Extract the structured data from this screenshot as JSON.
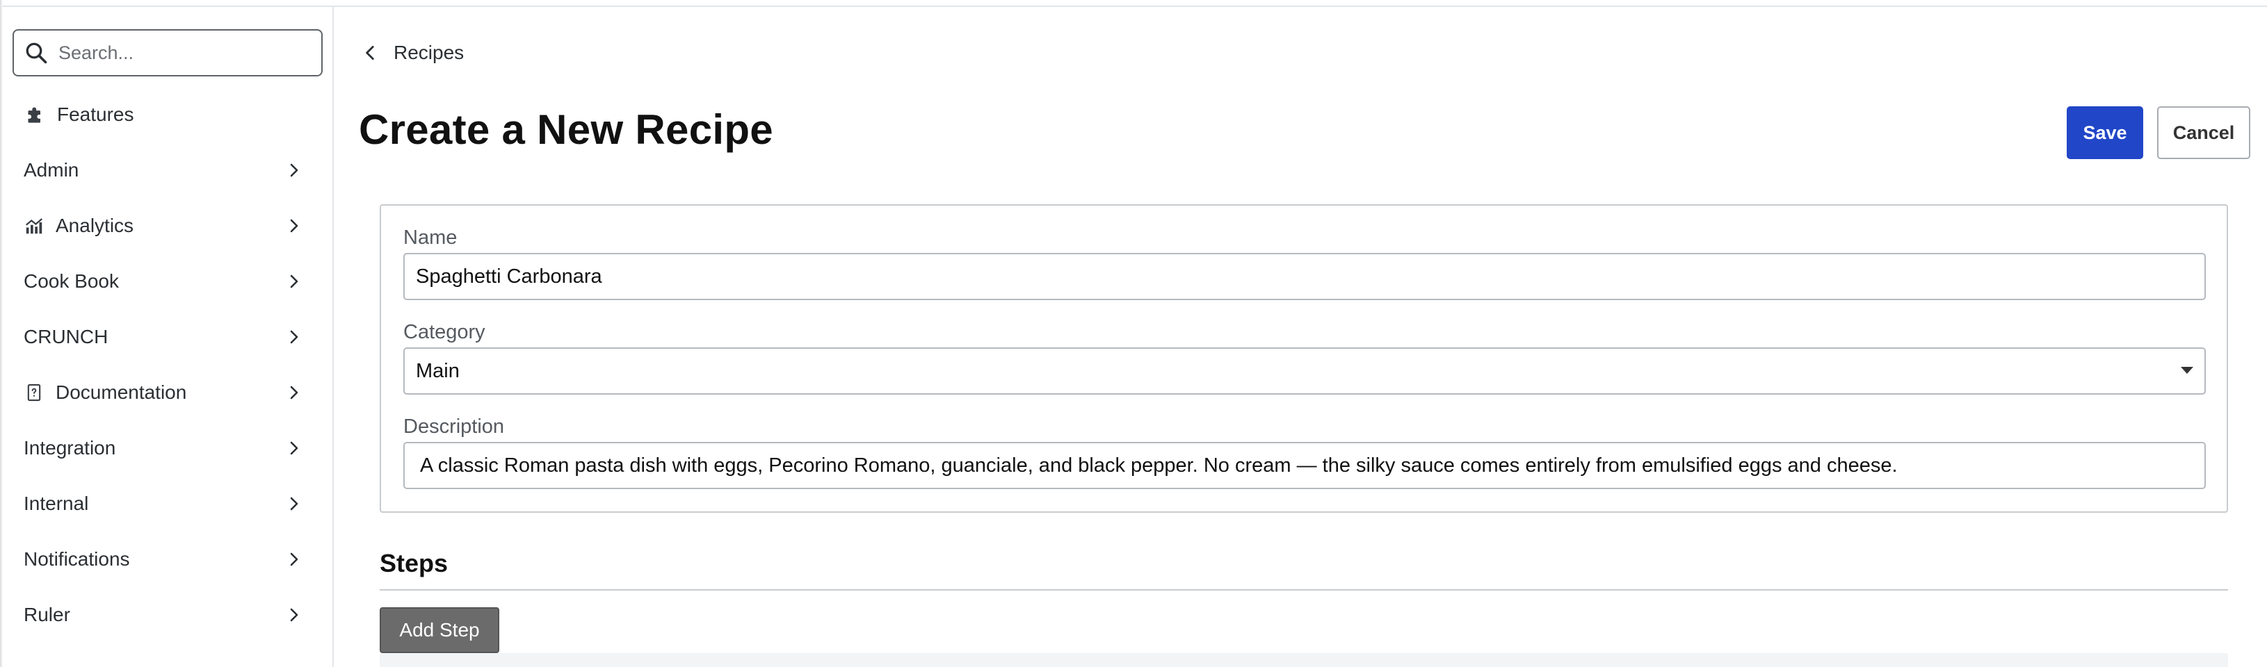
{
  "sidebar": {
    "search": {
      "placeholder": "Search..."
    },
    "items": [
      {
        "label": "Features",
        "icon": "puzzle-icon",
        "has_chevron": false
      },
      {
        "label": "Admin",
        "icon": null,
        "has_chevron": true
      },
      {
        "label": "Analytics",
        "icon": "chart-icon",
        "has_chevron": true
      },
      {
        "label": "Cook Book",
        "icon": null,
        "has_chevron": true
      },
      {
        "label": "CRUNCH",
        "icon": null,
        "has_chevron": true
      },
      {
        "label": "Documentation",
        "icon": "document-icon",
        "has_chevron": true
      },
      {
        "label": "Integration",
        "icon": null,
        "has_chevron": true
      },
      {
        "label": "Internal",
        "icon": null,
        "has_chevron": true
      },
      {
        "label": "Notifications",
        "icon": null,
        "has_chevron": true
      },
      {
        "label": "Ruler",
        "icon": null,
        "has_chevron": true
      }
    ]
  },
  "breadcrumb": {
    "label": "Recipes"
  },
  "page": {
    "title": "Create a New Recipe"
  },
  "actions": {
    "save_label": "Save",
    "cancel_label": "Cancel"
  },
  "form": {
    "name": {
      "label": "Name",
      "value": "Spaghetti Carbonara"
    },
    "category": {
      "label": "Category",
      "value": "Main"
    },
    "description": {
      "label": "Description",
      "value": "A classic Roman pasta dish with eggs, Pecorino Romano, guanciale, and black pepper. No cream — the silky sauce comes entirely from emulsified eggs and cheese."
    }
  },
  "steps": {
    "heading": "Steps",
    "add_label": "Add Step"
  },
  "colors": {
    "primary": "#2146c7",
    "secondary_button": "#6b6b6b",
    "border": "#c8cbcf"
  }
}
